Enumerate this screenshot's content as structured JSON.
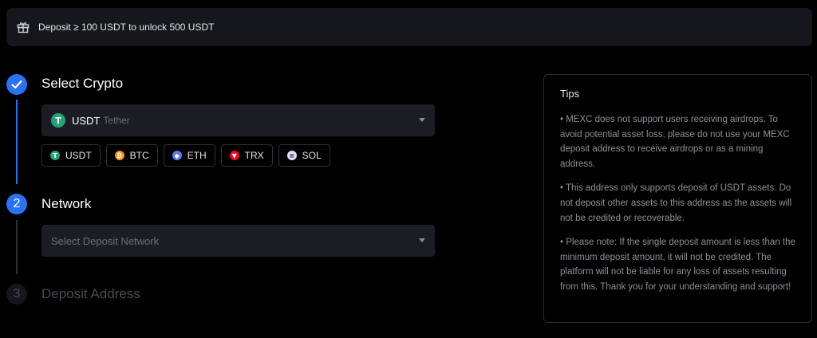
{
  "banner": {
    "icon": "gift-icon",
    "text": "Deposit ≥ 100 USDT to unlock 500 USDT"
  },
  "steps": [
    {
      "number": "✓",
      "title": "Select Crypto",
      "state": "done"
    },
    {
      "number": "2",
      "title": "Network",
      "state": "active"
    },
    {
      "number": "3",
      "title": "Deposit Address",
      "state": "inactive"
    }
  ],
  "crypto_select": {
    "symbol": "USDT",
    "name": "Tether",
    "icon_color": "#26a17b"
  },
  "quick_coins": [
    {
      "label": "USDT",
      "icon": "usdt-icon",
      "color": "#26a17b",
      "glyph": "T"
    },
    {
      "label": "BTC",
      "icon": "btc-icon",
      "color": "#f7931a",
      "glyph": "₿"
    },
    {
      "label": "ETH",
      "icon": "eth-icon",
      "color": "#627eea",
      "glyph": "◆"
    },
    {
      "label": "TRX",
      "icon": "trx-icon",
      "color": "#ef0027",
      "glyph": "▼"
    },
    {
      "label": "SOL",
      "icon": "sol-icon",
      "color": "#dfe3f5",
      "glyph": "≡"
    }
  ],
  "network_select": {
    "placeholder": "Select Deposit Network"
  },
  "tips": {
    "title": "Tips",
    "items": [
      "• MEXC does not support users receiving airdrops. To avoid potential asset loss, please do not use your MEXC deposit address to receive airdrops or as a mining address.",
      "• This address only supports deposit of USDT assets. Do not deposit other assets to this address as the assets will not be credited or recoverable.",
      "• Please note: If the single deposit amount is less than the minimum deposit amount, it will not be credited. The platform will not be liable for any loss of assets resulting from this. Thank you for your understanding and support!"
    ]
  },
  "colors": {
    "accent": "#2a72f0",
    "panel": "#1c1d24",
    "muted": "#8e9099"
  }
}
